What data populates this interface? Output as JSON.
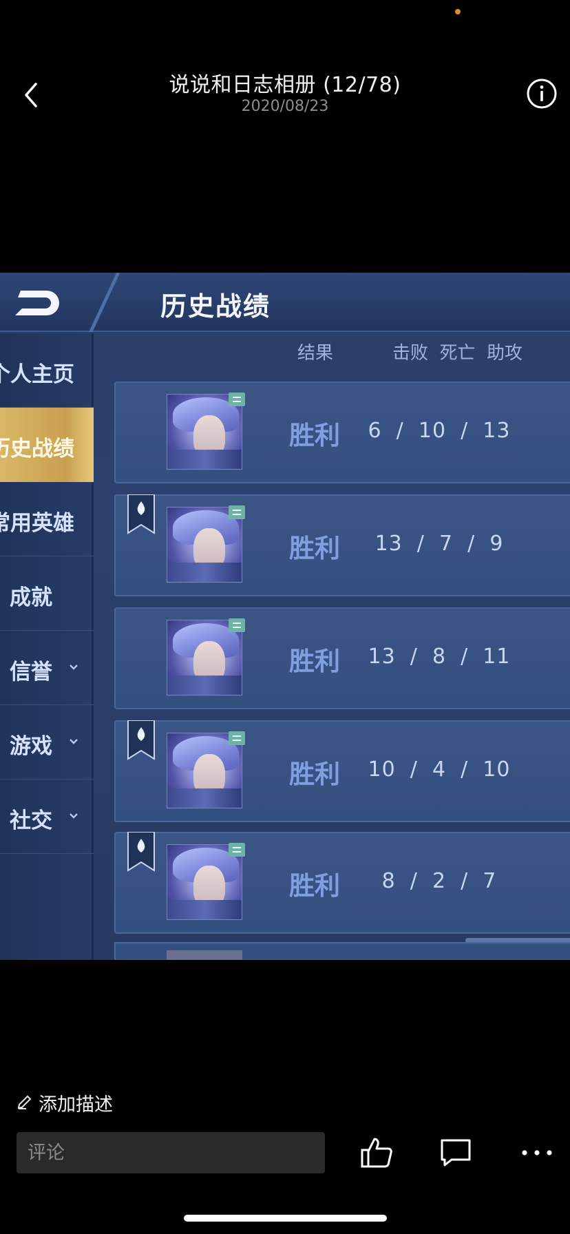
{
  "header": {
    "title": "说说和日志相册 (12/78)",
    "date": "2020/08/23"
  },
  "game": {
    "title": "历史战绩",
    "columns": {
      "result": "结果",
      "kda": "击败  死亡  助攻"
    },
    "sidebar": [
      {
        "label": "个人主页",
        "active": false
      },
      {
        "label": "历史战绩",
        "active": true
      },
      {
        "label": "常用英雄",
        "active": false
      },
      {
        "label": "成就",
        "active": false
      },
      {
        "label": "信誉",
        "active": false,
        "chevron": true
      },
      {
        "label": "游戏",
        "active": false,
        "chevron": true
      },
      {
        "label": "社交",
        "active": false,
        "chevron": true
      }
    ],
    "matches": [
      {
        "result": "胜利",
        "kda": "6  /  10  /  13",
        "mvp": false
      },
      {
        "result": "胜利",
        "kda": "13  /  7  /  9",
        "mvp": true
      },
      {
        "result": "胜利",
        "kda": "13  /  8  /  11",
        "mvp": false
      },
      {
        "result": "胜利",
        "kda": "10  /  4  /  10",
        "mvp": true
      },
      {
        "result": "胜利",
        "kda": "8  /  2  /  7",
        "mvp": true
      }
    ]
  },
  "footer": {
    "add_description": "添加描述",
    "comment_placeholder": "评论"
  },
  "icons": {
    "back": "chevron-left-icon",
    "info": "info-icon",
    "edit": "pencil-icon",
    "like": "thumbs-up-icon",
    "comment": "comment-icon",
    "more": "more-icon"
  },
  "colors": {
    "background": "#000000",
    "accent_dot": "#e0892f",
    "win_text": "#7f9fe0",
    "active_tab": "#d9b766"
  }
}
